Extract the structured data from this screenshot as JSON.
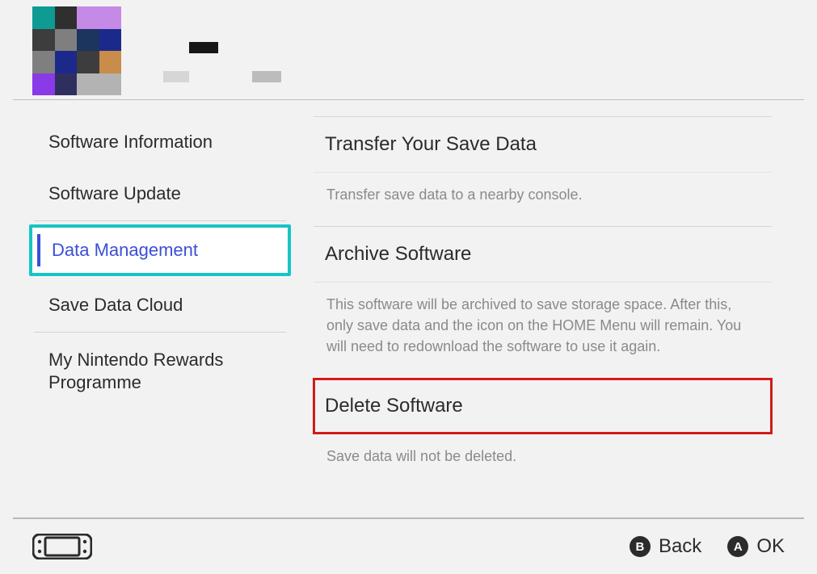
{
  "sidebar": {
    "items": [
      {
        "label": "Software Information"
      },
      {
        "label": "Software Update"
      },
      {
        "label": "Data Management"
      },
      {
        "label": "Save Data Cloud"
      },
      {
        "label": "My Nintendo Rewards Programme"
      }
    ],
    "selected_index": 2
  },
  "main": {
    "sections": [
      {
        "title": "Transfer Your Save Data",
        "desc": "Transfer save data to a nearby console.",
        "highlight": false
      },
      {
        "title": "Archive Software",
        "desc": "This software will be archived to save storage space. After this, only save data and the icon on the HOME Menu will remain. You will need to redownload the software to use it again.",
        "highlight": false
      },
      {
        "title": "Delete Software",
        "desc": "Save data will not be deleted.",
        "highlight": true
      }
    ]
  },
  "footer": {
    "back": {
      "button": "B",
      "label": "Back"
    },
    "ok": {
      "button": "A",
      "label": "OK"
    }
  },
  "icon_palette": [
    "#0d9b93",
    "#2f2f2f",
    "#c58ae6",
    "#c58ae6",
    "#3d3d3d",
    "#7f7f7f",
    "#1b355f",
    "#1b2a8a",
    "#7f7f7f",
    "#1b2a8a",
    "#3d3d3d",
    "#c98c4a",
    "#8a3ae6",
    "#2f2f5f",
    "#b3b3b3",
    "#b3b3b3"
  ]
}
